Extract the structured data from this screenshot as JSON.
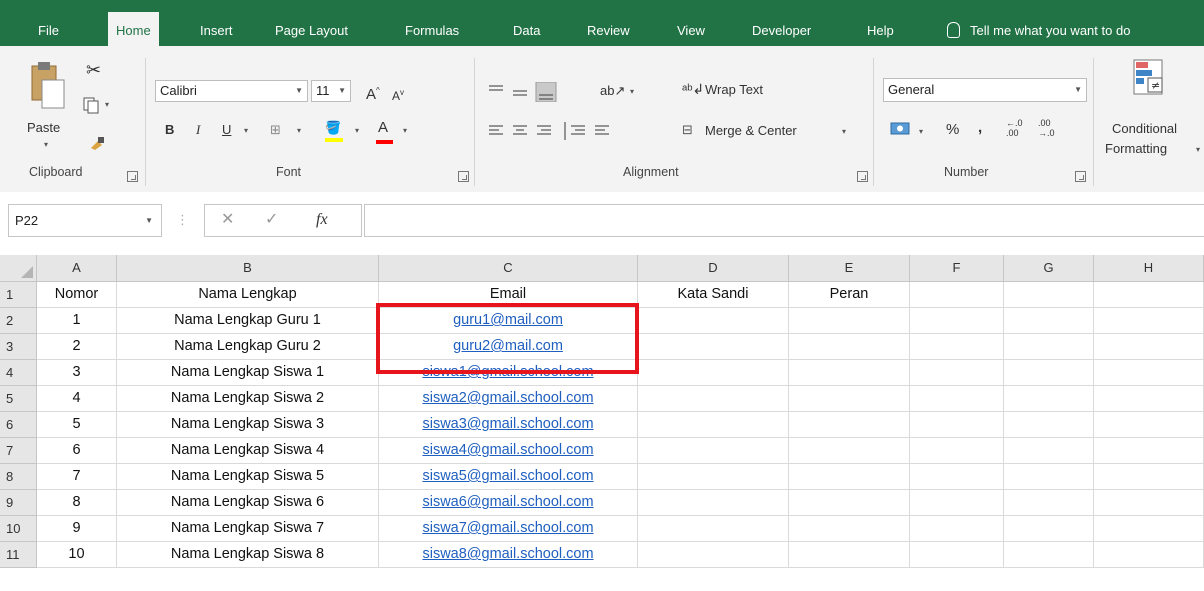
{
  "tabs": [
    "File",
    "Home",
    "Insert",
    "Page Layout",
    "Formulas",
    "Data",
    "Review",
    "View",
    "Developer",
    "Help"
  ],
  "tell_me": "Tell me what you want to do",
  "clipboard": {
    "paste_label": "Paste",
    "group_label": "Clipboard"
  },
  "font": {
    "name": "Calibri",
    "size": "11",
    "bold": "B",
    "italic": "I",
    "underline": "U",
    "font_color": "A",
    "grow": "A",
    "shrink": "A",
    "group_label": "Font"
  },
  "alignment": {
    "wrap_text": "Wrap Text",
    "merge_center": "Merge & Center",
    "group_label": "Alignment"
  },
  "number": {
    "format": "General",
    "percent": "%",
    "comma": ",",
    "increase_decimal": "←.0 .00",
    "decrease_decimal": ".00 →.0",
    "group_label": "Number"
  },
  "styles": {
    "conditional_formatting_line1": "Conditional",
    "conditional_formatting_line2": "Formatting"
  },
  "name_box": "P22",
  "formula_value": "",
  "columns": [
    "A",
    "B",
    "C",
    "D",
    "E",
    "F",
    "G",
    "H"
  ],
  "rows": [
    {
      "num": "1",
      "cells": [
        "Nomor",
        "Nama Lengkap",
        "Email",
        "Kata Sandi",
        "Peran",
        "",
        "",
        ""
      ]
    },
    {
      "num": "2",
      "cells": [
        "1",
        "Nama Lengkap Guru 1",
        "guru1@mail.com",
        "",
        "",
        "",
        "",
        ""
      ]
    },
    {
      "num": "3",
      "cells": [
        "2",
        "Nama Lengkap Guru 2",
        "guru2@mail.com",
        "",
        "",
        "",
        "",
        ""
      ]
    },
    {
      "num": "4",
      "cells": [
        "3",
        "Nama Lengkap Siswa 1",
        "siswa1@gmail.school.com",
        "",
        "",
        "",
        "",
        ""
      ]
    },
    {
      "num": "5",
      "cells": [
        "4",
        "Nama Lengkap Siswa 2",
        "siswa2@gmail.school.com",
        "",
        "",
        "",
        "",
        ""
      ]
    },
    {
      "num": "6",
      "cells": [
        "5",
        "Nama Lengkap Siswa 3",
        "siswa3@gmail.school.com",
        "",
        "",
        "",
        "",
        ""
      ]
    },
    {
      "num": "7",
      "cells": [
        "6",
        "Nama Lengkap Siswa 4",
        "siswa4@gmail.school.com",
        "",
        "",
        "",
        "",
        ""
      ]
    },
    {
      "num": "8",
      "cells": [
        "7",
        "Nama Lengkap Siswa 5",
        "siswa5@gmail.school.com",
        "",
        "",
        "",
        "",
        ""
      ]
    },
    {
      "num": "9",
      "cells": [
        "8",
        "Nama Lengkap Siswa 6",
        "siswa6@gmail.school.com",
        "",
        "",
        "",
        "",
        ""
      ]
    },
    {
      "num": "10",
      "cells": [
        "9",
        "Nama Lengkap Siswa 7",
        "siswa7@gmail.school.com",
        "",
        "",
        "",
        "",
        ""
      ]
    },
    {
      "num": "11",
      "cells": [
        "10",
        "Nama Lengkap Siswa 8",
        "siswa8@gmail.school.com",
        "",
        "",
        "",
        "",
        ""
      ]
    }
  ],
  "colors": {
    "ribbon_green": "#217346",
    "link_blue": "#1f5fbf",
    "highlight_red": "#e8141b"
  }
}
